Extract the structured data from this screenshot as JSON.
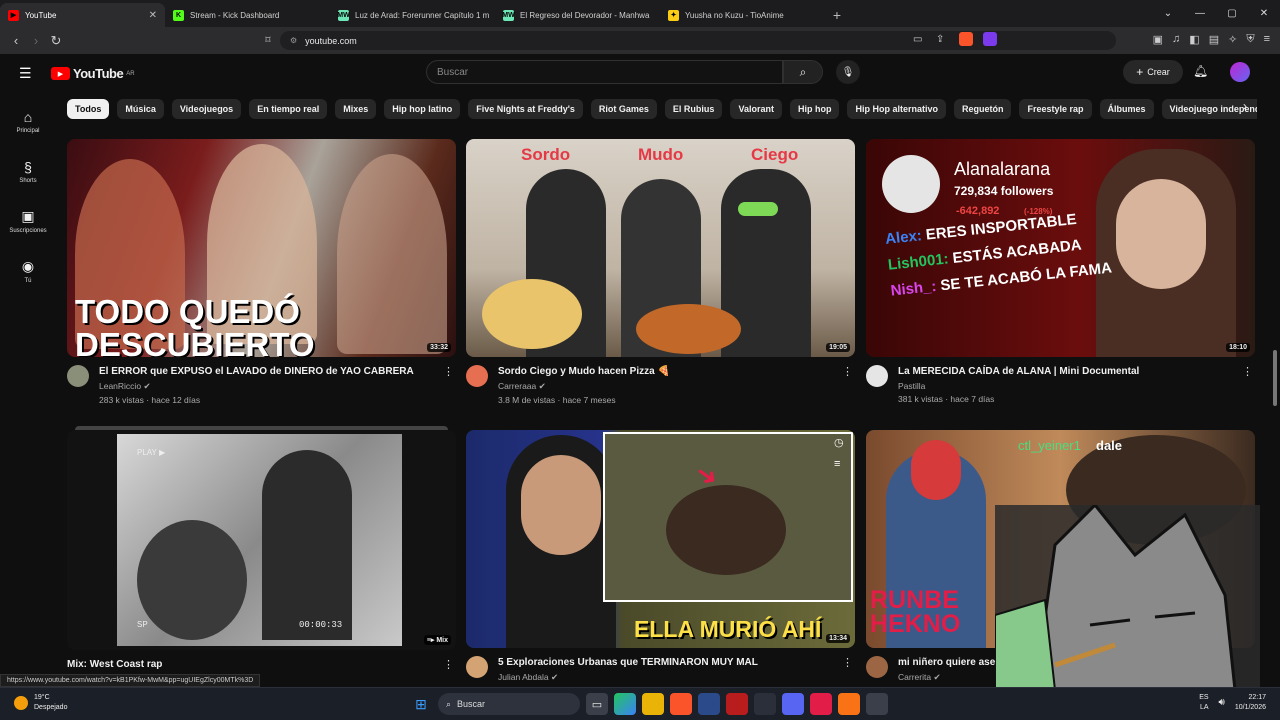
{
  "browser": {
    "tabs": [
      {
        "title": "YouTube",
        "active": true,
        "color": "#ff0000",
        "fav": "▶"
      },
      {
        "title": "Stream - Kick Dashboard",
        "active": false,
        "color": "#53fc18",
        "fav": "K"
      },
      {
        "title": "Luz de Arad: Forerunner Capítulo 1 m",
        "active": false,
        "color": "#6ee7b7",
        "fav": "MW"
      },
      {
        "title": "El Regreso del Devorador - Manhwa",
        "active": false,
        "color": "#6ee7b7",
        "fav": "MW"
      },
      {
        "title": "Yuusha no Kuzu - TioAnime",
        "active": false,
        "color": "#facc15",
        "fav": "✦"
      }
    ],
    "new_tab": "+",
    "url": "youtube.com"
  },
  "youtube": {
    "logo_text": "YouTube",
    "region": "AR",
    "search_placeholder": "Buscar",
    "create_label": "Crear",
    "sidebar": [
      {
        "label": "Principal",
        "icon": "home-icon",
        "glyph": "⌂"
      },
      {
        "label": "Shorts",
        "icon": "shorts-icon",
        "glyph": "§"
      },
      {
        "label": "Suscripciones",
        "icon": "subscriptions-icon",
        "glyph": "▣"
      },
      {
        "label": "Tú",
        "icon": "you-icon",
        "glyph": "◉"
      }
    ],
    "chips": [
      "Todos",
      "Música",
      "Videojuegos",
      "En tiempo real",
      "Mixes",
      "Hip hop latino",
      "Five Nights at Freddy's",
      "Riot Games",
      "El Rubius",
      "Valorant",
      "Hip hop",
      "Hip Hop alternativo",
      "Reguetón",
      "Freestyle rap",
      "Álbumes",
      "Videojuego independien"
    ],
    "videos": [
      {
        "title": "El ERROR que EXPUSO el LAVADO de DINERO de YAO CABRERA",
        "channel": "LeanRiccio",
        "verified": true,
        "stats": "283 k vistas · hace 12 días",
        "duration": "33:32",
        "overlay": [
          "TODO QUEDÓ",
          "DESCUBIERTO"
        ],
        "avatar_color": "#8a8f7a"
      },
      {
        "title": "Sordo Ciego y Mudo hacen Pizza 🍕",
        "channel": "Carreraaa",
        "verified": true,
        "stats": "3.8 M de vistas · hace 7 meses",
        "duration": "19:05",
        "overlay": [
          "Sordo",
          "Mudo",
          "Ciego"
        ],
        "avatar_color": "#e76f51"
      },
      {
        "title": "La MERECIDA CAÍDA de ALANA | Mini Documental",
        "channel": "Pastilla",
        "verified": false,
        "stats": "381 k vistas · hace 7 días",
        "duration": "18:10",
        "overlay_name": "Alanalarana",
        "overlay_followers": "729,834 followers",
        "overlay_drop": "-642,892",
        "overlay_pct": "(-128%)",
        "chat": [
          {
            "user": "Alex:",
            "msg": "ERES INSPORTABLE",
            "color": "#3b82f6"
          },
          {
            "user": "Lish001:",
            "msg": "ESTÁS ACABADA",
            "color": "#22c55e"
          },
          {
            "user": "Nish_:",
            "msg": "SE TE ACABÓ LA FAMA",
            "color": "#d946ef"
          }
        ],
        "avatar_color": "#e5e5e5"
      },
      {
        "title": "Mix: West Coast rap",
        "channel": "",
        "stats": "",
        "badge": "Mix",
        "overlay_play": "PLAY ▶",
        "overlay_time": "00:00:33",
        "overlay_sp": "SP"
      },
      {
        "title": "5 Exploraciones Urbanas que TERMINARON MUY MAL",
        "channel": "Julian Abdala",
        "verified": true,
        "stats": "",
        "duration": "13:34",
        "overlay": [
          "ELLA MURIÓ AHÍ"
        ],
        "avatar_color": "#d4a373"
      },
      {
        "title": "mi niñero quiere asesinarme",
        "channel": "Carrerita",
        "verified": true,
        "stats": "",
        "overlay_chat_user": "ctl_yeiner1",
        "overlay_chat_msg": "dale",
        "overlay_runbe": [
          "RUNBE",
          "HEKNO"
        ],
        "avatar_color": "#9c6644"
      }
    ]
  },
  "status_url": "https://www.youtube.com/watch?v=kB1PKfw-MwM&pp=ugUIEgZlcy00MTk%3D",
  "taskbar": {
    "temp": "19°C",
    "weather": "Despejado",
    "search": "Buscar",
    "lang": "ES",
    "lang2": "LA",
    "time": "22:17",
    "date": "10/1/2026"
  }
}
